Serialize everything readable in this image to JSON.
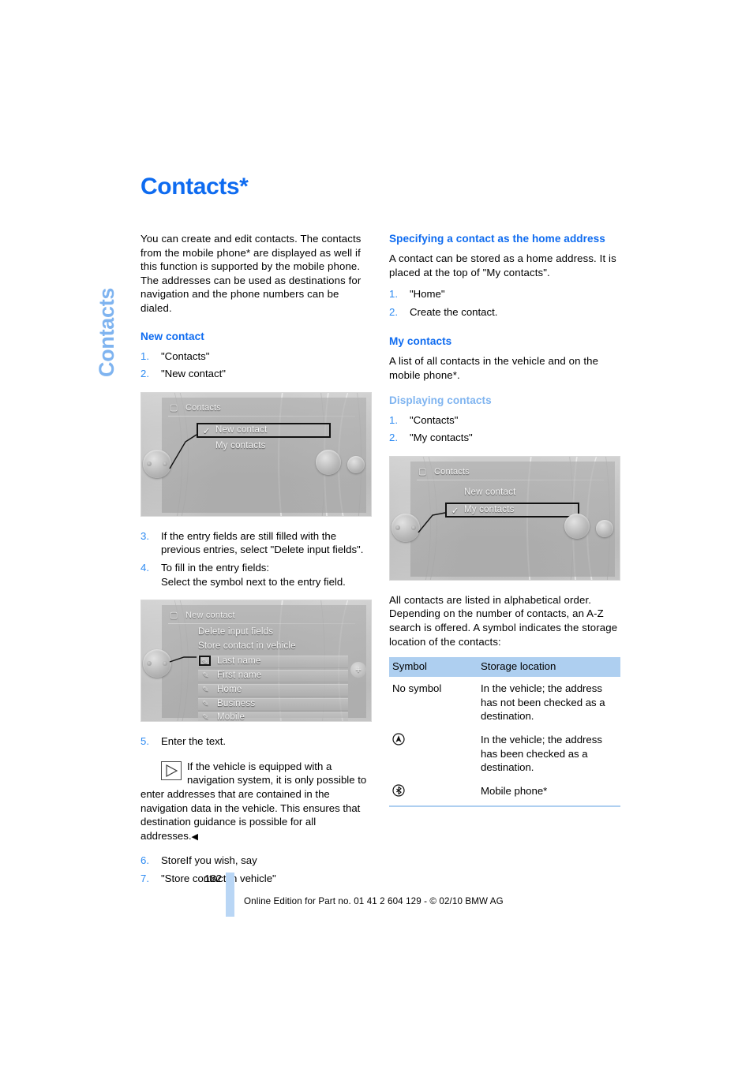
{
  "chapter_tab": "Contacts",
  "page_title": "Contacts*",
  "left_column": {
    "intro": "You can create and edit contacts. The contacts from the mobile phone* are displayed as well if this function is supported by the mobile phone. The addresses can be used as destinations for navigation and the phone numbers can be dialed.",
    "new_contact_heading": "New contact",
    "steps_1_2": [
      "\"Contacts\"",
      "\"New contact\""
    ],
    "figure1": {
      "menu_title": "Contacts",
      "title_icon": "contacts-card-icon",
      "items": [
        {
          "label": "New contact",
          "selected": true,
          "tick": "✓"
        },
        {
          "label": "My contacts",
          "selected": false,
          "tick": ""
        }
      ]
    },
    "steps_3_4": [
      "If the entry fields are still filled with the previous entries, select \"Delete input fields\".",
      "To fill in the entry fields:"
    ],
    "step4_sub": "Select the symbol next to the entry field.",
    "figure2": {
      "menu_title": "New contact",
      "title_icon": "new-contact-card-icon",
      "actions": [
        "Delete input fields",
        "Store contact in vehicle"
      ],
      "fields": [
        {
          "label": "Last name",
          "icon": "person-edit-icon",
          "highlighted": true
        },
        {
          "label": "First name",
          "icon": "person-edit-icon",
          "highlighted": false
        },
        {
          "label": "Home",
          "icon": "home-edit-icon",
          "highlighted": false
        },
        {
          "label": "Business",
          "icon": "building-edit-icon",
          "highlighted": false
        },
        {
          "label": "Mobile",
          "icon": "mobile-edit-icon",
          "highlighted": false
        }
      ],
      "plus_button": "+"
    },
    "step5": "Enter the text.",
    "tip": "If the vehicle is equipped with a navigation system, it is only possible to enter addresses that are contained in the navigation data in the vehicle. This ensures that destination guidance is possible for all addresses.",
    "tip_end_mark": "◀",
    "step6": "StoreIf you wish, say",
    "step7": "\"Store contact in vehicle\""
  },
  "right_column": {
    "home_address_heading": "Specifying a contact as the home address",
    "home_address_body": "A contact can be stored as a home address. It is placed at the top of \"My contacts\".",
    "home_address_steps": [
      "\"Home\"",
      "Create the contact."
    ],
    "my_contacts_heading": "My contacts",
    "my_contacts_body": "A list of all contacts in the vehicle and on the mobile phone*.",
    "displaying_heading": "Displaying contacts",
    "displaying_steps": [
      "\"Contacts\"",
      "\"My contacts\""
    ],
    "figure3": {
      "menu_title": "Contacts",
      "title_icon": "contacts-card-icon",
      "items": [
        {
          "label": "New contact",
          "selected": false,
          "tick": ""
        },
        {
          "label": "My contacts",
          "selected": true,
          "tick": "✓"
        }
      ]
    },
    "list_body": "All contacts are listed in alphabetical order. Depending on the number of contacts, an A-Z search is offered. A symbol indicates the storage location of the contacts:",
    "table": {
      "headers": [
        "Symbol",
        "Storage location"
      ],
      "rows": [
        {
          "symbol_text": "No symbol",
          "symbol_icon": "",
          "location": "In the vehicle; the address has not been checked as a destination."
        },
        {
          "symbol_text": "",
          "symbol_icon": "destination-arrow-icon",
          "location": "In the vehicle; the address has been checked as a destination."
        },
        {
          "symbol_text": "",
          "symbol_icon": "bluetooth-icon",
          "location": "Mobile phone*"
        }
      ]
    }
  },
  "footer": {
    "page_number": "182",
    "imprint": "Online Edition for Part no. 01 41 2 604 129 - © 02/10 BMW AG"
  },
  "colors": {
    "accent_blue": "#0E6BF0",
    "light_blue": "#7FB4F0",
    "table_header_blue": "#AECFF0",
    "footer_bar_blue": "#B9D6F5",
    "step_number_blue": "#2E8BF2"
  }
}
